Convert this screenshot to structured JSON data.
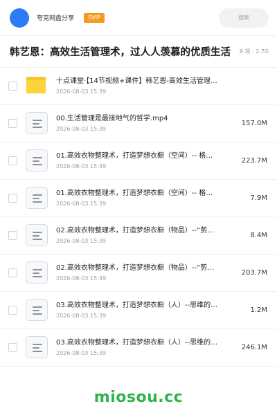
{
  "header": {
    "share_name": "夸克网盘分享",
    "badge": "SVIP",
    "search_placeholder": "搜索"
  },
  "title_bar": {
    "title": "韩艺恩：高效生活管理术，过人人羡慕的优质生活",
    "meta": "9 项 · 2.7G"
  },
  "files": [
    {
      "type": "folder",
      "name": "十点课堂·【14节视频+课件】韩艺恩-高效生活管理…",
      "date": "2026-08-03 15:39",
      "size": ""
    },
    {
      "type": "file",
      "name": "00.生活管理是最接地气的哲学.mp4",
      "date": "2026-08-03 15:39",
      "size": "157.0M"
    },
    {
      "type": "file",
      "name": "01.高效衣物整理术，打造梦想衣橱（空间）-- 格…",
      "date": "2026-08-03 15:39",
      "size": "223.7M"
    },
    {
      "type": "file",
      "name": "01.高效衣物整理术，打造梦想衣橱（空间）-- 格…",
      "date": "2026-08-03 15:39",
      "size": "7.9M"
    },
    {
      "type": "file",
      "name": "02.高效衣物整理术，打造梦想衣橱（物品）--“剪…",
      "date": "2026-08-03 15:39",
      "size": "8.4M"
    },
    {
      "type": "file",
      "name": "02.高效衣物整理术，打造梦想衣橱（物品）--“剪…",
      "date": "2026-08-03 15:39",
      "size": "203.7M"
    },
    {
      "type": "file",
      "name": "03.高效衣物整理术，打造梦想衣橱（人）--思维的…",
      "date": "2026-08-03 15:39",
      "size": "1.2M"
    },
    {
      "type": "file",
      "name": "03.高效衣物整理术，打造梦想衣橱（人）--思维的…",
      "date": "2026-08-03 15:39",
      "size": "246.1M"
    }
  ],
  "watermark": "miosou.cc",
  "colors": {
    "avatar": "#2f7bf5",
    "svip_badge": "#f59a23",
    "folder": "#fbd33a",
    "watermark": "#2fb34a"
  },
  "icons": {
    "folder": "folder-icon",
    "file": "document-icon"
  }
}
